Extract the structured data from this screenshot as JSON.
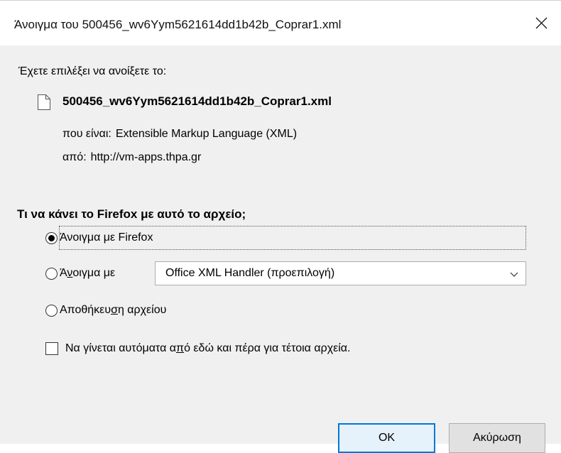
{
  "window": {
    "title": "Άνοιγμα του 500456_wv6Yym5621614dd1b42b_Coprar1.xml",
    "close_icon": "close-icon"
  },
  "intro": "Έχετε επιλέξει να ανοίξετε το:",
  "file": {
    "icon": "document-icon",
    "name": "500456_wv6Yym5621614dd1b42b_Coprar1.xml",
    "type_label": "που είναι:",
    "type_value": "Extensible Markup Language (XML)",
    "from_label": "από:",
    "from_value": "http://vm-apps.thpa.gr"
  },
  "question": "Τι να κάνει το Firefox με αυτό το αρχείο;",
  "options": {
    "open_with_firefox": {
      "label": "Άνοιγμα με Firefox",
      "checked": true
    },
    "open_with": {
      "label_pre": "Ά",
      "label_accel": "ν",
      "label_post": "οιγμα με",
      "checked": false,
      "selected_app": "Office XML Handler (προεπιλογή)"
    },
    "save_file": {
      "label_pre": "Αποθήκευ",
      "label_accel": "σ",
      "label_post": "η αρχείου",
      "checked": false
    }
  },
  "remember": {
    "label_pre": "Να γίνεται αυτόματα α",
    "label_accel": "π",
    "label_post": "ό εδώ και πέρα για τέτοια αρχεία.",
    "checked": false
  },
  "buttons": {
    "ok": "OK",
    "cancel": "Ακύρωση"
  }
}
